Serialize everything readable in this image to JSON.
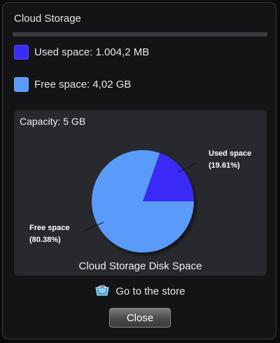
{
  "window": {
    "title": "Cloud Storage"
  },
  "legend": {
    "used": {
      "label": "Used space: 1.004,2 MB",
      "color": "#3a2cf5"
    },
    "free": {
      "label": "Free space: 4,02 GB",
      "color": "#5a9bfa"
    }
  },
  "capacity_label": "Capacity: 5 GB",
  "chart_data": {
    "type": "pie",
    "title": "Cloud Storage Disk Space",
    "slices": [
      {
        "name": "Used space",
        "value": 19.61,
        "label_name": "Used space",
        "label_pct": "(19.61%)",
        "color": "#3a2cf5"
      },
      {
        "name": "Free space",
        "value": 80.38,
        "label_name": "Free space",
        "label_pct": "(80.38%)",
        "color": "#5a9bfa"
      }
    ]
  },
  "store_link": {
    "label": "Go to the store",
    "icon": "store-icon"
  },
  "buttons": {
    "close": "Close"
  }
}
